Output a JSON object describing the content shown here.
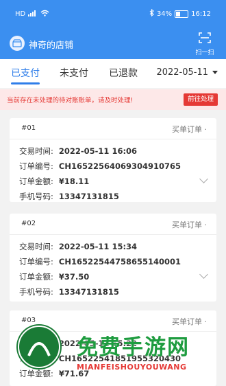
{
  "status_bar": {
    "signal": "HD",
    "battery": "34%",
    "battery_level": 0.34,
    "time": "16:12"
  },
  "header": {
    "store_name": "神奇的店铺",
    "scan_label": "扫一扫"
  },
  "tabs": {
    "items": [
      "已支付",
      "未支付",
      "已退款"
    ],
    "selected": "已支付"
  },
  "date_filter": {
    "value": "2022-05-11"
  },
  "alert": {
    "message": "当前存在未处理的待对账账单，请及时处理!",
    "action_label": "前往处理"
  },
  "labels": {
    "time": "交易时间:",
    "order_no": "订单编号:",
    "amount": "订单金额:",
    "phone": "手机号码:"
  },
  "orders": [
    {
      "no": "#01",
      "type": "买单订单",
      "time": "2022-05-11 16:06",
      "order_no": "CH16522564069304910765",
      "amount": "¥18.11",
      "phone": "13347131815"
    },
    {
      "no": "#02",
      "type": "买单订单",
      "time": "2022-05-11 15:34",
      "order_no": "CH16522544758655140001",
      "amount": "¥37.50",
      "phone": "13347131815"
    },
    {
      "no": "#03",
      "type": "买单订单",
      "time": "2022-05-11 15:22",
      "order_no": "CH16522541851955320430",
      "amount": "¥71.67",
      "phone": ""
    }
  ],
  "watermark": {
    "title": "免费手游网",
    "subtitle": "MIANFEISHOUYOUWANG"
  },
  "colors": {
    "brand": "#3b8ff0",
    "accent": "#2f7ee9",
    "alert": "#e53935",
    "watermark": "#1e9c3f"
  }
}
